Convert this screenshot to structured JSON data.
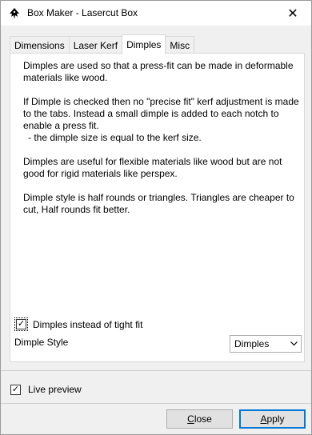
{
  "window": {
    "title": "Box Maker - Lasercut Box",
    "close_glyph": "✕"
  },
  "tabs": [
    {
      "label": "Dimensions",
      "active": false
    },
    {
      "label": "Laser Kerf",
      "active": false
    },
    {
      "label": "Dimples",
      "active": true
    },
    {
      "label": "Misc",
      "active": false
    }
  ],
  "panel": {
    "paragraphs": [
      "Dimples are used so that a press-fit can be made in deformable materials like wood.",
      "If Dimple is checked then no \"precise fit\" kerf adjustment is made to the tabs. Instead a small dimple is added to each notch to enable a press fit.",
      "- the dimple size is equal to the kerf size.",
      "Dimples are useful for flexible materials like wood but are not good for rigid materials like perspex.",
      "Dimple style is half rounds or triangles. Triangles are cheaper to cut, Half rounds fit better."
    ],
    "dimple_checkbox": {
      "label": "Dimples instead of tight fit",
      "checked": true
    },
    "dimple_style": {
      "label": "Dimple Style",
      "value": "Dimples"
    }
  },
  "live_preview": {
    "label": "Live preview",
    "checked": true
  },
  "buttons": {
    "close_label_u": "C",
    "close_label_rest": "lose",
    "apply_label_u": "A",
    "apply_label_rest": "pply"
  },
  "icons": {
    "app": "inkscape-icon",
    "check": "✓",
    "dropdown": "chevron-down-icon"
  }
}
